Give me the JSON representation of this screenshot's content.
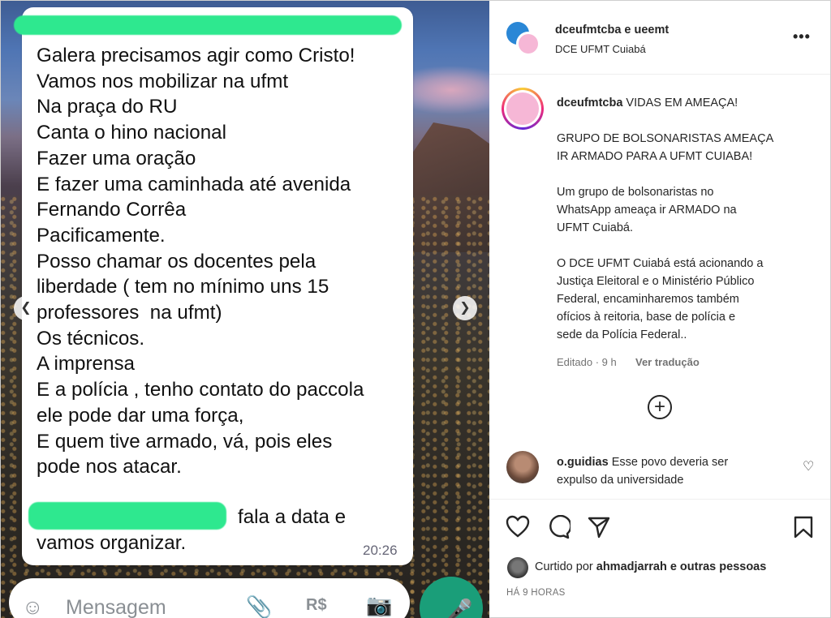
{
  "chat": {
    "message_lines": [
      "Galera precisamos agir como Cristo!",
      "Vamos nos mobilizar na ufmt",
      "Na praça do RU",
      "Canta o hino nacional",
      "Fazer uma oração",
      "E fazer uma caminhada até avenida",
      "Fernando Corrêa",
      "Pacificamente.",
      "Posso chamar os docentes pela",
      "liberdade ( tem no mínimo uns 15",
      "professores  na ufmt)",
      "Os técnicos.",
      "A imprensa",
      "E a polícia , tenho contato do paccola",
      "ele pode dar uma força,",
      "E quem tive armado, vá, pois eles",
      "pode nos atacar."
    ],
    "footer_line1": "fala a data e",
    "footer_line2": "vamos organizar.",
    "time": "20:26",
    "input_placeholder": "Mensagem",
    "redaction_color": "#2ee88f"
  },
  "post": {
    "header_accounts": "dceufmtcba e ueemt",
    "header_location": "DCE UFMT Cuiabá",
    "more_icon": "more-horizontal-icon",
    "caption_user": "dceufmtcba",
    "caption_text": "VIDAS EM AMEAÇA!\n\nGRUPO DE BOLSONARISTAS AMEAÇA\nIR ARMADO PARA A UFMT CUIABA!\n\nUm grupo de bolsonaristas no\nWhatsApp ameaça ir ARMADO na\nUFMT Cuiabá.\n\nO DCE UFMT Cuiabá está acionando a\nJustiça Eleitoral e o Ministério Público\nFederal, encaminharemos também\nofícios à reitoria, base de polícia e\nsede da Polícia Federal..",
    "caption_meta": "Editado · 9 h",
    "translate_link": "Ver tradução",
    "comment_user": "o.guidias",
    "comment_text_1": "Esse povo deveria ser",
    "comment_text_2": "expulso da universidade",
    "liked_prefix": "Curtido por",
    "liked_user": "ahmadjarrah",
    "liked_suffix": "e outras pessoas",
    "time_ago": "HÁ 9 HORAS"
  }
}
